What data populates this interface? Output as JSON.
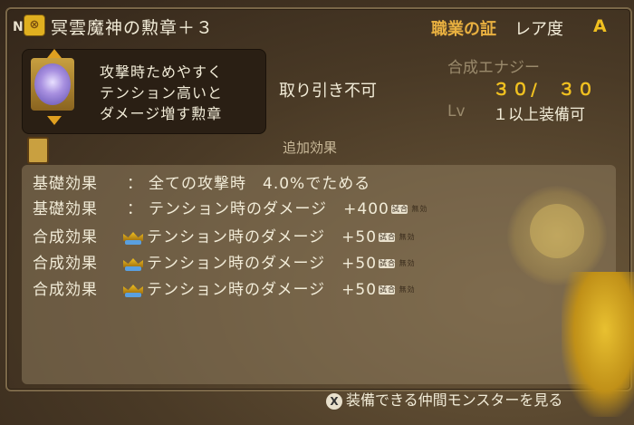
{
  "header": {
    "n_badge": "N",
    "item_icon": "medal-icon",
    "title": "冥雲魔神の勲章＋３",
    "cert_label": "職業の証",
    "rarity_label": "レア度",
    "rarity_value": "A"
  },
  "description": {
    "lines": [
      "攻撃時ためやすく",
      "テンション高いと",
      "ダメージ増す勲章"
    ]
  },
  "info": {
    "tradable": "取り引き不可",
    "synth_label": "合成エナジー",
    "synth_value": "３０/　３０",
    "lv_label": "Lv",
    "lv_value": "１以上装備可"
  },
  "effects": {
    "heading": "追加効果",
    "rows": [
      {
        "label": "基礎効果",
        "sep": "：",
        "text": "全ての攻撃時　4.0%でためる",
        "value": "",
        "crown": false,
        "tag": ""
      },
      {
        "label": "基礎効果",
        "sep": "：",
        "text": "テンション時のダメージ",
        "value": "+400",
        "crown": false,
        "tag": "試合 無効"
      },
      {
        "label": "合成効果",
        "sep": "",
        "text": "テンション時のダメージ",
        "value": "+50",
        "crown": true,
        "tag": "試合 無効"
      },
      {
        "label": "合成効果",
        "sep": "",
        "text": "テンション時のダメージ",
        "value": "+50",
        "crown": true,
        "tag": "試合 無効"
      },
      {
        "label": "合成効果",
        "sep": "",
        "text": "テンション時のダメージ",
        "value": "+50",
        "crown": true,
        "tag": "試合 無効"
      }
    ]
  },
  "footer": {
    "button_glyph": "X",
    "label": "装備できる仲間モンスターを見る"
  },
  "colors": {
    "gold": "#f0c020",
    "cert": "#e8b040",
    "text": "#f2ecd8"
  }
}
